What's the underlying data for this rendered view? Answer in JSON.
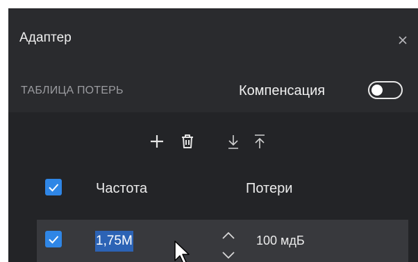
{
  "dialog": {
    "title": "Адаптер",
    "close_icon": "close-icon"
  },
  "section": {
    "label": "ТАБЛИЦА ПОТЕРЬ",
    "compensation_label": "Компенсация",
    "compensation_enabled": false
  },
  "toolbar": {
    "icons": [
      "add-icon",
      "trash-icon",
      "download-icon",
      "upload-icon"
    ]
  },
  "table": {
    "select_all_checked": true,
    "columns": [
      "Частота",
      "Потери"
    ],
    "rows": [
      {
        "checked": true,
        "frequency": "1,75M",
        "loss": "100 мдБ",
        "frequency_selected": true
      }
    ]
  },
  "colors": {
    "panel_bg": "#232427",
    "header_bg": "#2a2b2e",
    "row_bg": "#38393d",
    "accent": "#2f86e6",
    "selection": "#2c63b5",
    "muted_text": "#9b9ca0",
    "text": "#f0f0f0"
  }
}
